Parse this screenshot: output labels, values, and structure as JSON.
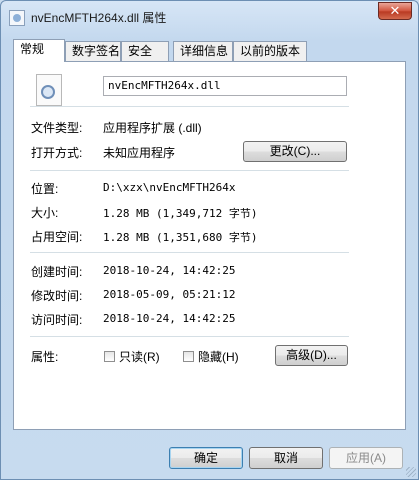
{
  "window": {
    "title": "nvEncMFTH264x.dll 属性",
    "close_label": "✕"
  },
  "tabs": [
    "常规",
    "数字签名",
    "安全",
    "详细信息",
    "以前的版本"
  ],
  "general": {
    "filename": "nvEncMFTH264x.dll",
    "file_type_label": "文件类型:",
    "file_type_value": "应用程序扩展 (.dll)",
    "opens_with_label": "打开方式:",
    "opens_with_value": "未知应用程序",
    "change_button": "更改(C)...",
    "location_label": "位置:",
    "location_value": "D:\\xzx\\nvEncMFTH264x",
    "size_label": "大小:",
    "size_value": "1.28 MB (1,349,712 字节)",
    "size_on_disk_label": "占用空间:",
    "size_on_disk_value": "1.28 MB (1,351,680 字节)",
    "created_label": "创建时间:",
    "created_value": "2018-10-24, 14:42:25",
    "modified_label": "修改时间:",
    "modified_value": "2018-05-09, 05:21:12",
    "accessed_label": "访问时间:",
    "accessed_value": "2018-10-24, 14:42:25",
    "attributes_label": "属性:",
    "readonly_label": "只读(R)",
    "hidden_label": "隐藏(H)",
    "advanced_button": "高级(D)..."
  },
  "footer": {
    "ok": "确定",
    "cancel": "取消",
    "apply": "应用(A)"
  }
}
